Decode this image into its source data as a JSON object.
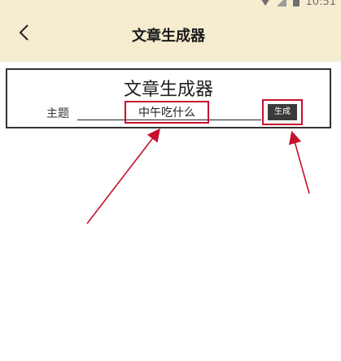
{
  "status_bar": {
    "time": "10:51"
  },
  "header": {
    "title": "文章生成器",
    "back_icon": "chevron-left-icon"
  },
  "card": {
    "title": "文章生成器",
    "topic_label": "主题",
    "topic_value": "中午吃什么",
    "generate_label": "生成"
  },
  "colors": {
    "topbar_bg": "#f6eccf",
    "highlight": "#c8102e",
    "button_bg": "#3a3a3a"
  }
}
